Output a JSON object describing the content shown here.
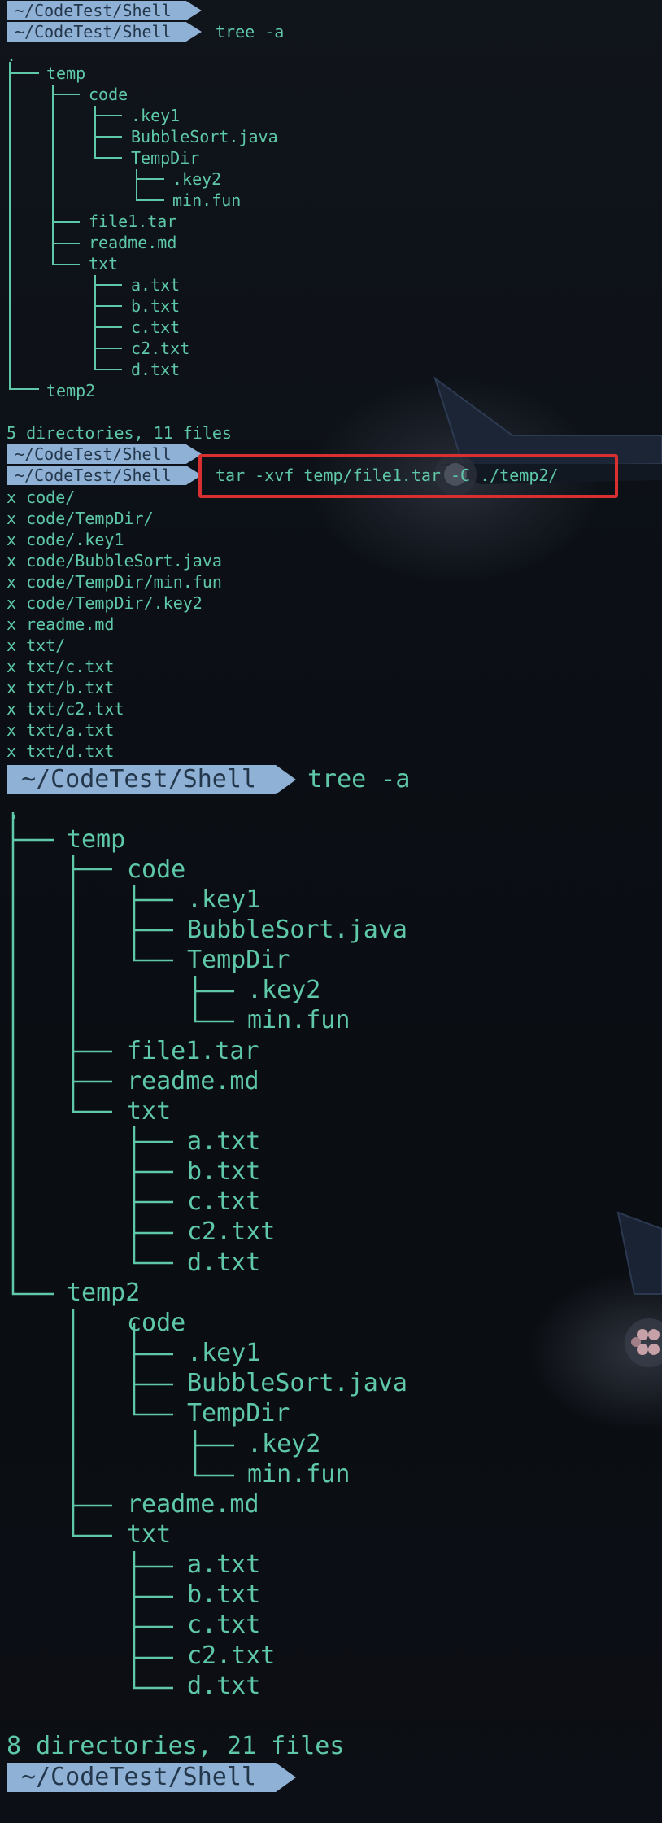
{
  "prompt_path": "~/CodeTest/Shell",
  "commands": {
    "tree": "tree -a",
    "tar": "tar -xvf temp/file1.tar -C ./temp2/"
  },
  "tree1": {
    "root": ".",
    "temp": "temp",
    "code": "code",
    "key1": ".key1",
    "bubble": "BubbleSort.java",
    "tempdir": "TempDir",
    "key2": ".key2",
    "minfun": "min.fun",
    "file1": "file1.tar",
    "readme": "readme.md",
    "txt": "txt",
    "a": "a.txt",
    "b": "b.txt",
    "c": "c.txt",
    "c2": "c2.txt",
    "d": "d.txt",
    "temp2": "temp2",
    "summary": "5 directories, 11 files"
  },
  "tar_output": [
    "x code/",
    "x code/TempDir/",
    "x code/.key1",
    "x code/BubbleSort.java",
    "x code/TempDir/min.fun",
    "x code/TempDir/.key2",
    "x readme.md",
    "x txt/",
    "x txt/c.txt",
    "x txt/b.txt",
    "x txt/c2.txt",
    "x txt/a.txt",
    "x txt/d.txt"
  ],
  "tree2": {
    "root": ".",
    "summary": "8 directories, 21 files"
  },
  "colors": {
    "text": "#5ec8a8",
    "prompt_bg": "#8fb1d6",
    "prompt_fg": "#23364a",
    "highlight": "#d83030",
    "background": "#0a0d12"
  }
}
